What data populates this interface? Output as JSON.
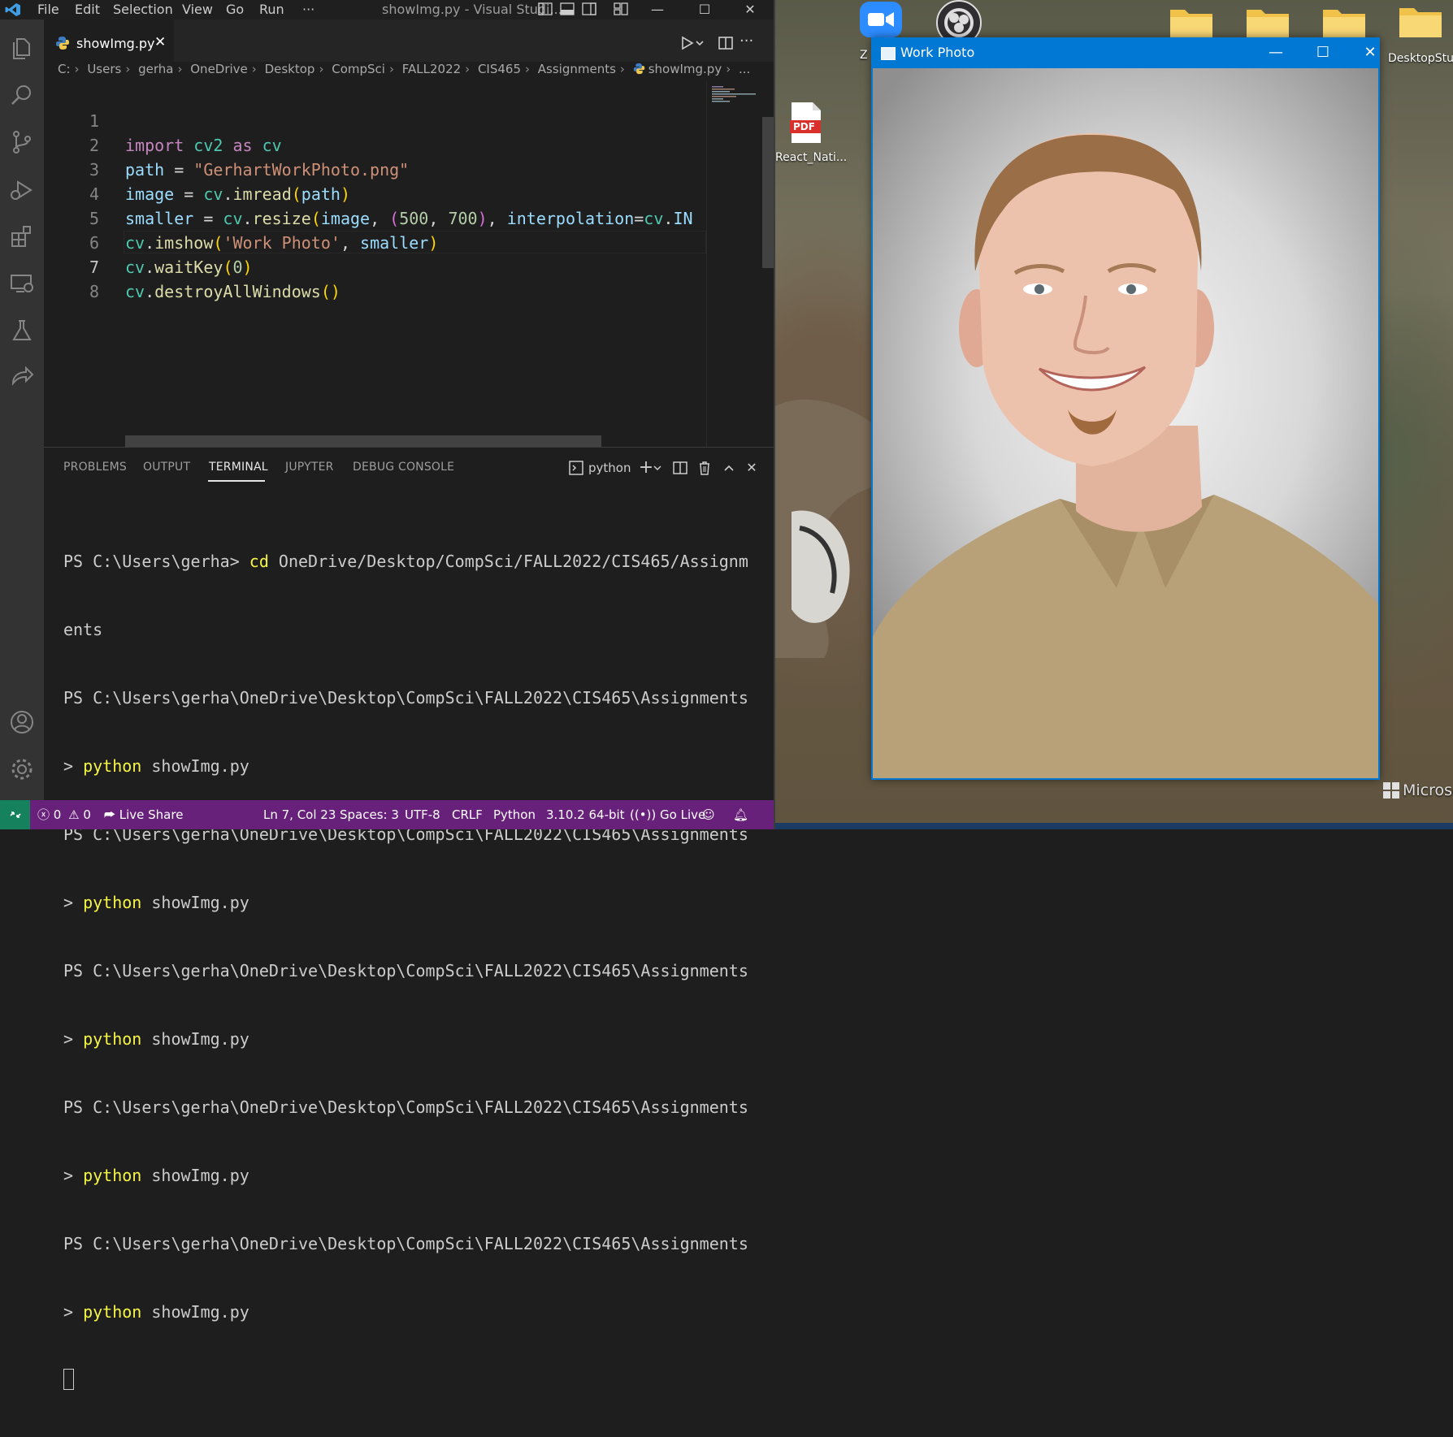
{
  "titlebar": {
    "menus": [
      "File",
      "Edit",
      "Selection",
      "View",
      "Go",
      "Run",
      "···"
    ],
    "title": "showImg.py - Visual Studi..."
  },
  "tab": {
    "label": "showImg.py",
    "close": "✕"
  },
  "breadcrumb": [
    "C:",
    "Users",
    "gerha",
    "OneDrive",
    "Desktop",
    "CompSci",
    "FALL2022",
    "CIS465",
    "Assignments",
    "showImg.py",
    "..."
  ],
  "code": {
    "line_numbers": [
      "1",
      "2",
      "3",
      "4",
      "5",
      "6",
      "7",
      "8"
    ],
    "lines": [
      "import cv2 as cv",
      "path = \"GerhartWorkPhoto.png\"",
      "image = cv.imread(path)",
      "smaller = cv.resize(image, (500, 700), interpolation=cv.IN",
      "cv.imshow('Work Photo', smaller)",
      "cv.waitKey(0)",
      "cv.destroyAllWindows()",
      ""
    ]
  },
  "panel": {
    "tabs": [
      "PROBLEMS",
      "OUTPUT",
      "TERMINAL",
      "JUPYTER",
      "DEBUG CONSOLE"
    ],
    "active_tab": "TERMINAL",
    "terminal_name": "python"
  },
  "terminal": {
    "lines": [
      "PS C:\\Users\\gerha> cd OneDrive/Desktop/CompSci/FALL2022/CIS465/Assignm",
      "ents",
      "PS C:\\Users\\gerha\\OneDrive\\Desktop\\CompSci\\FALL2022\\CIS465\\Assignments",
      "> python showImg.py",
      "PS C:\\Users\\gerha\\OneDrive\\Desktop\\CompSci\\FALL2022\\CIS465\\Assignments",
      "> python showImg.py",
      "PS C:\\Users\\gerha\\OneDrive\\Desktop\\CompSci\\FALL2022\\CIS465\\Assignments",
      "> python showImg.py",
      "PS C:\\Users\\gerha\\OneDrive\\Desktop\\CompSci\\FALL2022\\CIS465\\Assignments",
      "> python showImg.py",
      "PS C:\\Users\\gerha\\OneDrive\\Desktop\\CompSci\\FALL2022\\CIS465\\Assignments",
      "> python showImg.py"
    ],
    "prompt_prefix": "PS C:\\Users\\gerha> ",
    "cmd_cd": "cd",
    "cmd_cd_rest": " OneDrive/Desktop/CompSci/FALL2022/CIS465/Assignm",
    "cmd_wrap": "ents",
    "ps_path": "PS C:\\Users\\gerha\\OneDrive\\Desktop\\CompSci\\FALL2022\\CIS465\\Assignments",
    "gt": "> ",
    "python": "python",
    "script": " showImg.py"
  },
  "statusbar": {
    "errors": "0",
    "warnings": "0",
    "live_share": "Live Share",
    "position": "Ln 7, Col 23",
    "spaces": "Spaces: 3",
    "encoding": "UTF-8",
    "eol": "CRLF",
    "language": "Python",
    "interpreter": "3.10.2 64-bit",
    "go_live": "Go Live"
  },
  "desktop": {
    "pdf_label": "React_Nati...",
    "zoom_label": "Z",
    "folder_label": "DesktopStuf",
    "ms_text": "Microso",
    "pdf_text": "PDF"
  },
  "image_window": {
    "title": "Work Photo",
    "minimize": "—",
    "maximize": "☐",
    "close": "✕"
  },
  "colors": {
    "status_bar": "#68217a",
    "remote": "#16825d",
    "window_accent": "#0078d4",
    "editor_bg": "#1e1e1e"
  }
}
